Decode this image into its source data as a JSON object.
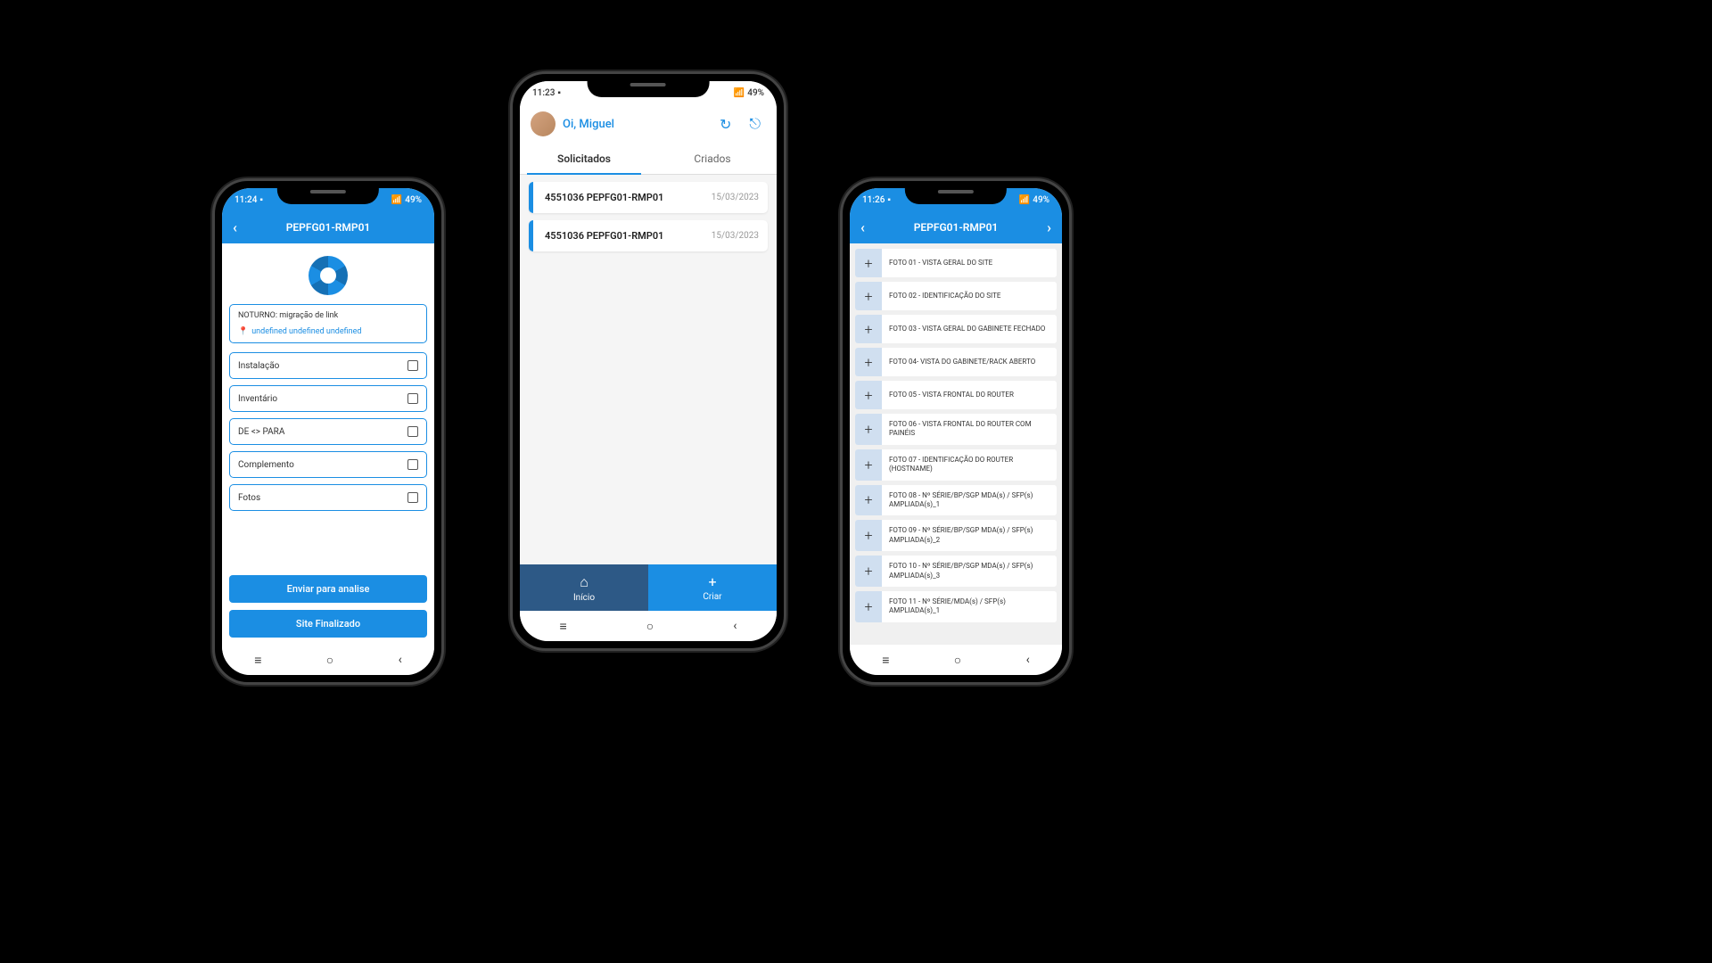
{
  "status": {
    "time1": "11:24",
    "time2": "11:23",
    "time3": "11:26",
    "signal": "📶",
    "batteryPct": "49%"
  },
  "phone1": {
    "title": "PEPFG01-RMP01",
    "info_line1": "NOTURNO: migração de link",
    "info_location": "undefined undefined undefined",
    "checks": [
      "Instalação",
      "Inventário",
      "DE <> PARA",
      "Complemento",
      "Fotos"
    ],
    "btn_analyze": "Enviar para analise",
    "btn_finalize": "Site Finalizado"
  },
  "phone2": {
    "greeting": "Oi, Miguel",
    "tab_left": "Solicitados",
    "tab_right": "Criados",
    "rows": [
      {
        "title": "4551036 PEPFG01-RMP01",
        "date": "15/03/2023"
      },
      {
        "title": "4551036 PEPFG01-RMP01",
        "date": "15/03/2023"
      }
    ],
    "nav_home": "Início",
    "nav_create": "Criar"
  },
  "phone3": {
    "title": "PEPFG01-RMP01",
    "photos": [
      "FOTO 01 - VISTA GERAL DO SITE",
      "FOTO 02 - IDENTIFICAÇÃO DO SITE",
      "FOTO 03 - VISTA GERAL DO GABINETE FECHADO",
      "FOTO 04- VISTA DO GABINETE/RACK ABERTO",
      "FOTO 05 - VISTA FRONTAL DO ROUTER",
      "FOTO 06 - VISTA FRONTAL DO ROUTER COM PAINÉIS",
      "FOTO 07 - IDENTIFICAÇÃO DO ROUTER (HOSTNAME)",
      "FOTO 08 - Nº SÉRIE/BP/SGP MDA(s) / SFP(s) AMPLIADA(s)_1",
      "FOTO 09 - Nº SÉRIE/BP/SGP MDA(s) / SFP(s) AMPLIADA(s)_2",
      "FOTO 10 - Nº SÉRIE/BP/SGP MDA(s) / SFP(s) AMPLIADA(s)_3",
      "FOTO 11 - Nº SÉRIE/MDA(s) / SFP(s) AMPLIADA(s)_1"
    ]
  }
}
